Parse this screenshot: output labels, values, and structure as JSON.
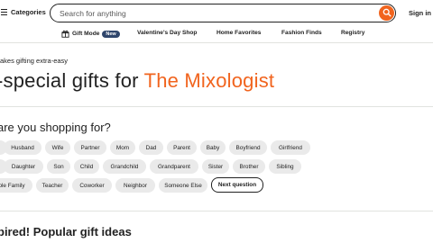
{
  "header": {
    "menu_label": "Categories",
    "search_placeholder": "Search for anything",
    "signin_label": "Sign in"
  },
  "nav": {
    "items": [
      {
        "label": "Gift Mode",
        "badge": "New",
        "icon": "gift-icon"
      },
      {
        "label": "Valentine's Day Shop"
      },
      {
        "label": "Home Favorites"
      },
      {
        "label": "Fashion Finds"
      },
      {
        "label": "Registry"
      }
    ]
  },
  "hero": {
    "kicker": "akes gifting extra-easy",
    "headline_prefix": "-special gifts for ",
    "headline_accent": "The Mixologist"
  },
  "shopping_for": {
    "question": "are you shopping for?",
    "rows": [
      [
        "",
        "Husband",
        "Wife",
        "Partner",
        "Mom",
        "Dad",
        "Parent",
        "Baby",
        "Boyfriend",
        "Girlfriend"
      ],
      [
        "",
        "Daughter",
        "Son",
        "Child",
        "Grandchild",
        "Grandparent",
        "Sister",
        "Brother",
        "Sibling"
      ],
      [
        "ole Family",
        "Teacher",
        "Coworker",
        "Neighbor",
        "Someone Else",
        "Next question"
      ]
    ]
  },
  "popular": {
    "heading": "pired! Popular gift ideas"
  },
  "colors": {
    "accent": "#f1641e",
    "chip_bg": "#eaeaea",
    "badge_bg": "#2f466c"
  }
}
